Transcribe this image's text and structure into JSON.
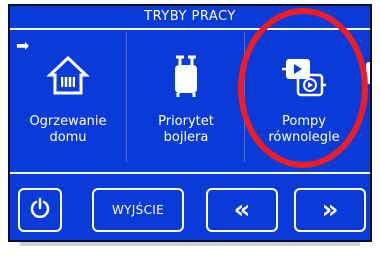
{
  "header": {
    "title": "TRYBY PRACY"
  },
  "tiles": [
    {
      "label_line1": "Ogrzewanie",
      "label_line2": "domu",
      "icon": "house-heating-icon"
    },
    {
      "label_line1": "Priorytet",
      "label_line2": "bojlera",
      "icon": "boiler-icon"
    },
    {
      "label_line1": "Pompy",
      "label_line2": "równolegle",
      "icon": "parallel-pumps-icon"
    }
  ],
  "footer": {
    "power_icon": "power-icon",
    "exit_label": "WYJŚCIE",
    "prev_glyph": "«",
    "next_glyph": "»"
  },
  "colors": {
    "screen_bg": "#0a3bd8",
    "text": "#ffffff",
    "highlight_circle": "#ee1c24"
  }
}
